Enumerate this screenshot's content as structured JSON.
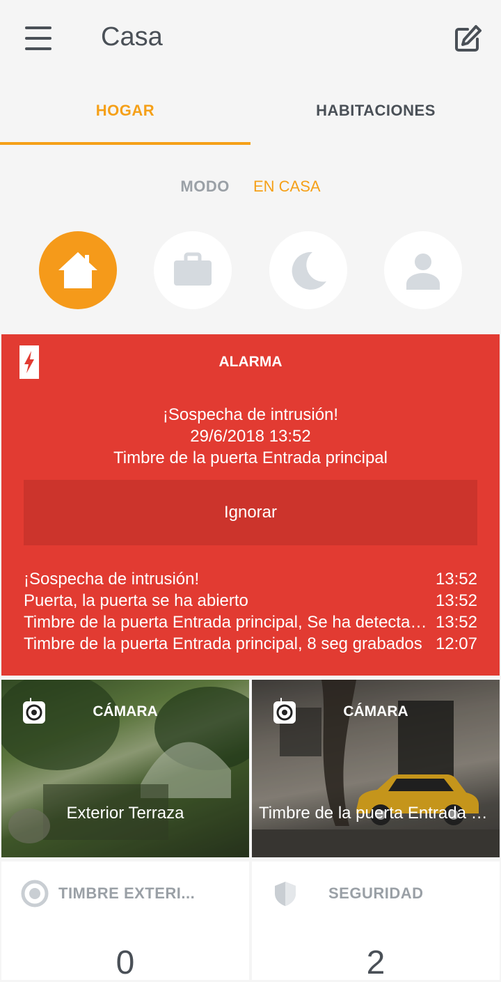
{
  "header": {
    "title": "Casa"
  },
  "tabs": [
    {
      "label": "HOGAR",
      "active": true
    },
    {
      "label": "HABITACIONES",
      "active": false
    }
  ],
  "mode": {
    "label": "MODO",
    "value": "EN CASA",
    "options": [
      {
        "icon": "home-icon",
        "active": true
      },
      {
        "icon": "briefcase-icon",
        "active": false
      },
      {
        "icon": "moon-icon",
        "active": false
      },
      {
        "icon": "person-icon",
        "active": false
      }
    ]
  },
  "alarm": {
    "title": "ALARMA",
    "message_line1": "¡Sospecha de intrusión!",
    "message_line2": "29/6/2018 13:52",
    "message_line3": "Timbre de la puerta Entrada principal",
    "ignore_label": "Ignorar",
    "events": [
      {
        "text": "¡Sospecha de intrusión!",
        "time": "13:52"
      },
      {
        "text": "Puerta, la puerta se ha abierto",
        "time": "13:52"
      },
      {
        "text": "Timbre de la puerta Entrada principal, Se ha detectado movimiento",
        "time": "13:52"
      },
      {
        "text": "Timbre de la puerta Entrada principal, 8 seg grabados",
        "time": "12:07"
      }
    ]
  },
  "cameras": [
    {
      "label": "CÁMARA",
      "name": "Exterior Terraza"
    },
    {
      "label": "CÁMARA",
      "name": "Timbre de la puerta Entrada principal"
    }
  ],
  "cards": [
    {
      "label": "TIMBRE EXTERI...",
      "value": "0",
      "icon": "doorbell-icon"
    },
    {
      "label": "SEGURIDAD",
      "value": "2",
      "icon": "shield-icon"
    }
  ],
  "colors": {
    "accent": "#f5a018",
    "alarm": "#e23b32",
    "alarm_button": "#cc342c",
    "text_dark": "#4a5057",
    "text_muted": "#9aa0a6"
  }
}
